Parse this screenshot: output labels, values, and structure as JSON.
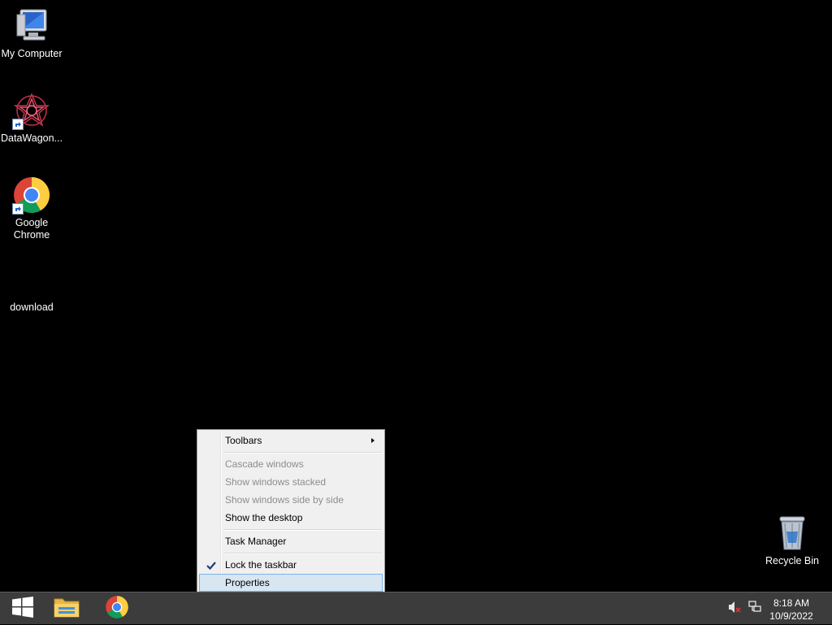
{
  "desktop": {
    "icons": [
      {
        "label": "My Computer",
        "icon": "computer-icon"
      },
      {
        "label": "DataWagon...",
        "icon": "datawagon-icon"
      },
      {
        "label": "Google Chrome",
        "icon": "chrome-icon"
      },
      {
        "label": "download",
        "icon": "file-icon"
      },
      {
        "label": "Recycle Bin",
        "icon": "recycle-bin-icon"
      }
    ]
  },
  "context_menu": {
    "items": [
      {
        "label": "Toolbars",
        "state": "enabled",
        "submenu": true
      },
      {
        "label": "Cascade windows",
        "state": "disabled"
      },
      {
        "label": "Show windows stacked",
        "state": "disabled"
      },
      {
        "label": "Show windows side by side",
        "state": "disabled"
      },
      {
        "label": "Show the desktop",
        "state": "enabled"
      },
      {
        "label": "Task Manager",
        "state": "enabled"
      },
      {
        "label": "Lock the taskbar",
        "state": "enabled",
        "checked": true
      },
      {
        "label": "Properties",
        "state": "highlighted"
      }
    ]
  },
  "taskbar": {
    "buttons": [
      {
        "name": "start-button",
        "icon": "windows-logo-icon"
      },
      {
        "name": "file-explorer-button",
        "icon": "folder-icon"
      },
      {
        "name": "chrome-taskbar-button",
        "icon": "chrome-icon"
      }
    ],
    "tray": {
      "volume_icon": "volume-muted-icon",
      "network_icon": "network-icon",
      "time": "8:18 AM",
      "date": "10/9/2022"
    }
  },
  "colors": {
    "desktop_background": "#000000",
    "taskbar": "#3c3c3c",
    "menu_background": "#f0f0f0",
    "menu_highlight": "#d8e6f2",
    "menu_highlight_border": "#7eb4ea"
  }
}
